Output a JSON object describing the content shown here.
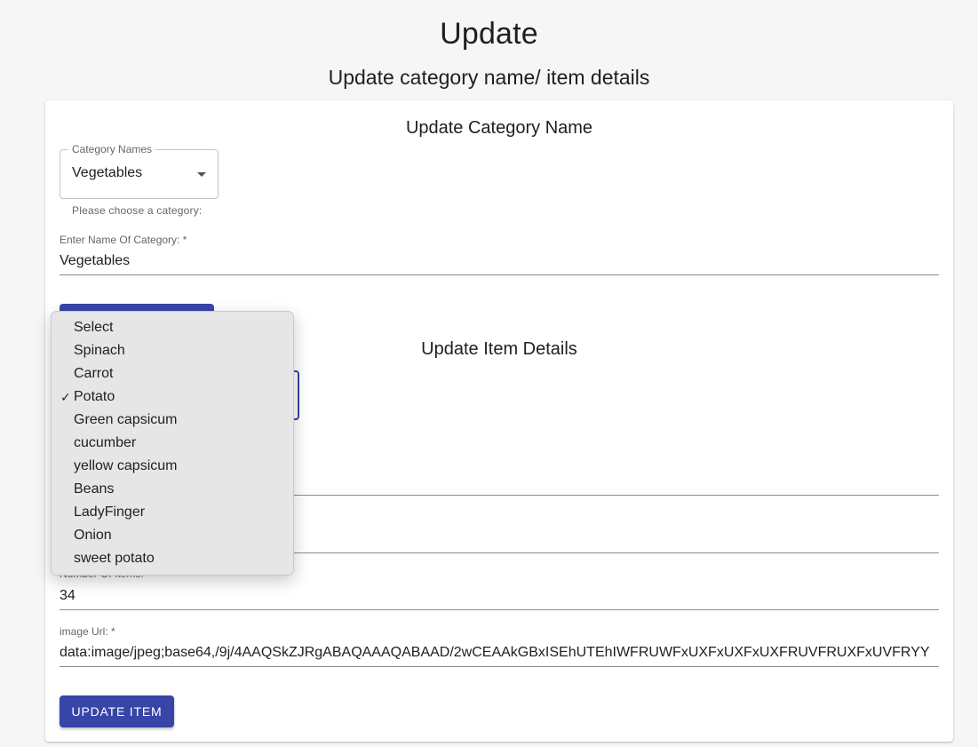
{
  "page": {
    "title": "Update",
    "subtitle": "Update category name/ item details"
  },
  "category_section": {
    "title": "Update Category Name",
    "select": {
      "legend": "Category Names",
      "value": "Vegetables",
      "helper": "Please choose a category:"
    },
    "name_field": {
      "label": "Enter Name Of Category: *",
      "value": "Vegetables"
    }
  },
  "item_section": {
    "title": "Update Item Details",
    "count_field": {
      "label": "Number Of Items:",
      "value": "34"
    },
    "image_field": {
      "label": "image Url: *",
      "value": "data:image/jpeg;base64,/9j/4AAQSkZJRgABAQAAAQABAAD/2wCEAAkGBxISEhUTEhIWFRUWFxUXFxUXFxUXFRUVFRUXFxUVFRYY"
    },
    "update_button": "UPDATE ITEM"
  },
  "dropdown": {
    "selected": "Potato",
    "options": [
      "Select",
      "Spinach",
      "Carrot",
      "Potato",
      "Green capsicum",
      "cucumber",
      "yellow capsicum",
      "Beans",
      "LadyFinger",
      "Onion",
      "sweet potato"
    ]
  },
  "colors": {
    "primary": "#3745a8",
    "dropdown_bg": "#e6e6e6",
    "page_bg": "#f6f6f6"
  }
}
